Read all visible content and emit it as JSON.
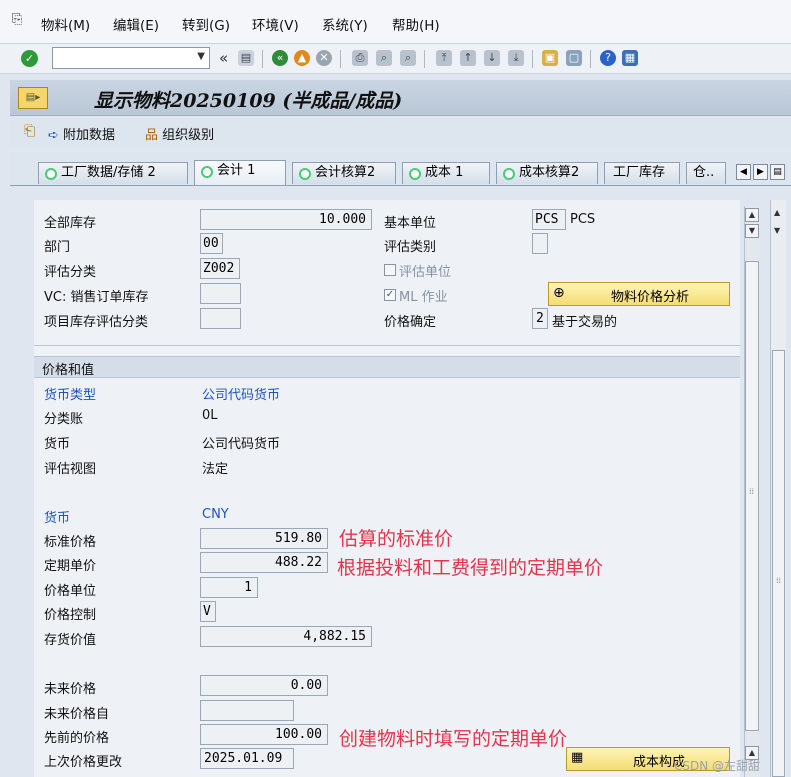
{
  "menu": {
    "items": [
      "物料(M)",
      "编辑(E)",
      "转到(G)",
      "环境(V)",
      "系统(Y)",
      "帮助(H)"
    ]
  },
  "toolbar": {
    "command_value": "",
    "back_symbol": "«"
  },
  "title": {
    "text": "显示物料20250109 (半成品/成品)"
  },
  "app_toolbar": {
    "additional_data": "附加数据",
    "org_levels": "组织级别"
  },
  "tabs": [
    {
      "label": "工厂数据/存储 2",
      "active": false
    },
    {
      "label": "会计 1",
      "active": true
    },
    {
      "label": "会计核算2",
      "active": false
    },
    {
      "label": "成本 1",
      "active": false
    },
    {
      "label": "成本核算2",
      "active": false
    },
    {
      "label": "工厂库存",
      "active": false
    },
    {
      "label": "仓..",
      "active": false
    }
  ],
  "general": {
    "total_stock_label": "全部库存",
    "total_stock_value": "10.000",
    "base_unit_label": "基本单位",
    "base_unit_code": "PCS",
    "base_unit_text": "PCS",
    "division_label": "部门",
    "division_value": "00",
    "valuation_cat_label": "评估类别",
    "valuation_cat_value": "",
    "valuation_class_label": "评估分类",
    "valuation_class_value": "Z002",
    "valuated_unit_label": "评估单位",
    "valuated_unit_checked": false,
    "vc_label": "VC: 销售订单库存",
    "vc_value": "",
    "ml_label": "ML 作业",
    "ml_checked": true,
    "price_analysis_button": "物料价格分析",
    "project_stock_label": "项目库存评估分类",
    "project_stock_value": "",
    "price_determination_label": "价格确定",
    "price_determination_code": "2",
    "price_determination_text": "基于交易的"
  },
  "prices": {
    "section_title": "价格和值",
    "currency_type_label": "货币类型",
    "currency_type_value": "公司代码货币",
    "ledger_label": "分类账",
    "ledger_value": "0L",
    "currency_label": "货币",
    "currency_value": "公司代码货币",
    "valuation_view_label": "评估视图",
    "valuation_view_value": "法定",
    "currency2_label": "货币",
    "currency2_value": "CNY",
    "standard_price_label": "标准价格",
    "standard_price_value": "519.80",
    "standard_price_note": "估算的标准价",
    "periodic_price_label": "定期单价",
    "periodic_price_value": "488.22",
    "periodic_price_note": "根据投料和工费得到的定期单价",
    "price_unit_label": "价格单位",
    "price_unit_value": "1",
    "price_control_label": "价格控制",
    "price_control_value": "V",
    "inventory_value_label": "存货价值",
    "inventory_value_value": "4,882.15",
    "future_price_label": "未来价格",
    "future_price_value": "0.00",
    "future_price_from_label": "未来价格自",
    "future_price_from_value": "",
    "previous_price_label": "先前的价格",
    "previous_price_value": "100.00",
    "previous_price_note": "创建物料时填写的定期单价",
    "last_change_label": "上次价格更改",
    "last_change_value": "2025.01.09",
    "cost_structure_button": "成本构成"
  },
  "watermark": "CSDN @左甜甜"
}
